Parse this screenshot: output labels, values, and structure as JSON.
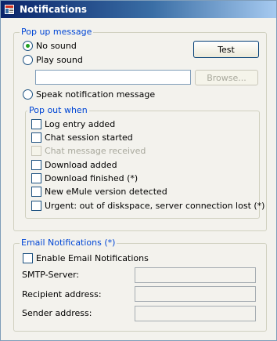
{
  "window": {
    "title": "Notifications",
    "icon": "notification-app-icon"
  },
  "popup": {
    "group_label": "Pop up message",
    "options": [
      {
        "label": "No sound",
        "selected": true
      },
      {
        "label": "Play sound",
        "selected": false
      },
      {
        "label": "Speak notification message",
        "selected": false
      }
    ],
    "test_label": "Test",
    "sound_file_value": "",
    "browse_label": "Browse..."
  },
  "popout": {
    "group_label": "Pop out when",
    "items": [
      {
        "label": "Log entry added",
        "checked": false,
        "enabled": true
      },
      {
        "label": "Chat session started",
        "checked": false,
        "enabled": true
      },
      {
        "label": "Chat message received",
        "checked": false,
        "enabled": false
      },
      {
        "label": "Download added",
        "checked": false,
        "enabled": true
      },
      {
        "label": "Download finished (*)",
        "checked": false,
        "enabled": true
      },
      {
        "label": "New eMule version detected",
        "checked": false,
        "enabled": true
      },
      {
        "label": "Urgent: out of diskspace, server connection lost (*)",
        "checked": false,
        "enabled": true
      }
    ]
  },
  "email": {
    "group_label": "Email Notifications (*)",
    "enable_label": "Enable Email Notifications",
    "enable_checked": false,
    "smtp_label": "SMTP-Server:",
    "smtp_value": "",
    "recipient_label": "Recipient address:",
    "recipient_value": "",
    "sender_label": "Sender address:",
    "sender_value": ""
  }
}
